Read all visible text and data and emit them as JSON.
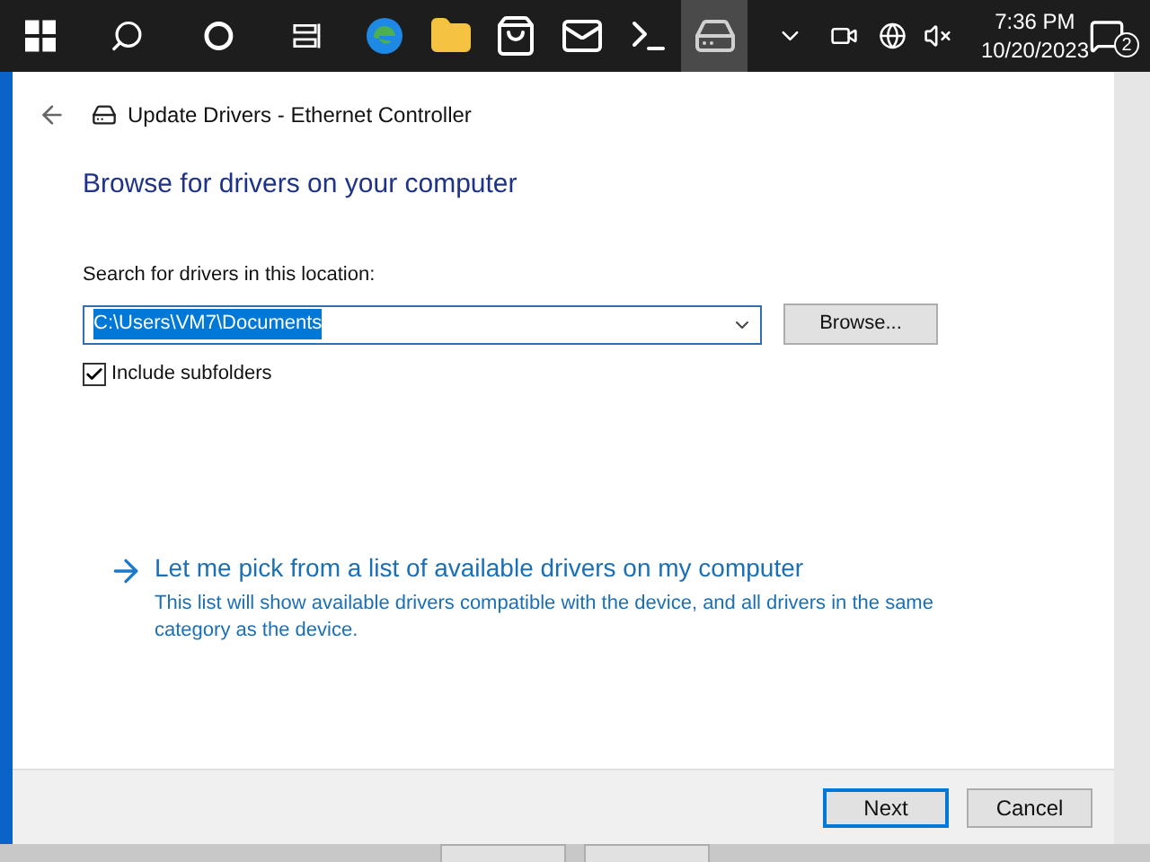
{
  "taskbar": {
    "apps": [
      {
        "kind": "edge",
        "selected": false
      },
      {
        "kind": "explorer",
        "selected": false
      },
      {
        "kind": "store",
        "selected": false
      },
      {
        "kind": "mail",
        "selected": false
      },
      {
        "kind": "terminal",
        "selected": false
      },
      {
        "kind": "device",
        "selected": true
      }
    ],
    "time": "7:36 PM",
    "date": "10/20/2023",
    "notification_count": "2"
  },
  "dialog": {
    "title": "Update Drivers - Ethernet Controller",
    "heading": "Browse for drivers on your computer",
    "location_label": "Search for drivers in this location:",
    "location_value": "C:\\Users\\VM7\\Documents",
    "browse_button": "Browse...",
    "include_subfolders": {
      "label": "Include subfolders",
      "checked": true
    },
    "pick_link": "Let me pick from a list of available drivers on my computer",
    "pick_description": "This list will show available drivers compatible with the device, and all drivers in the same category as the device.",
    "buttons": [
      {
        "label": "Next",
        "selected": true
      },
      {
        "label": "Cancel",
        "selected": false
      }
    ]
  }
}
